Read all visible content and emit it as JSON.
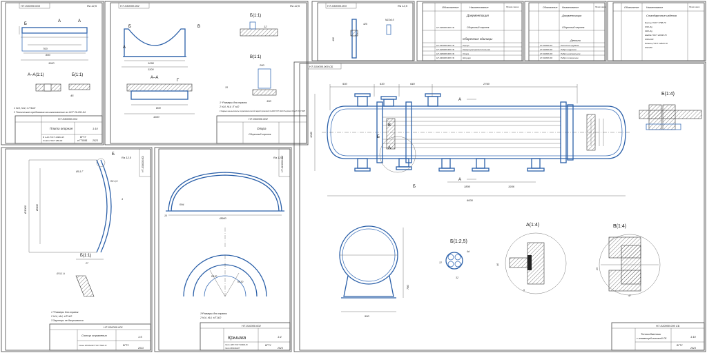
{
  "sheets": {
    "s1": {
      "stamp": "НТ-030000.004",
      "roughness": "Ra 12,5",
      "name": "Плита опорная",
      "mat1": "В 1-20 ГОСТ 19903-15",
      "mat2": "Ст3сп ГОСТ 380-94",
      "org1": "ВГТУ",
      "org2": "в ГТ0081",
      "year": "2023",
      "scale": "1:10",
      "section_aa": "A–A(1:1)",
      "view_b": "Б(1:1)",
      "label_b": "Б",
      "label_a": "A",
      "note1": "1 h14, h14, ± IT14/2",
      "note2": "2 Технические требования на изготовление по ОСТ 26-291-94",
      "dims": [
        "700",
        "800",
        "1100",
        "60",
        "45",
        "3"
      ]
    },
    "s2": {
      "stamp": "НТ-030000.002",
      "roughness": "Ra 12,5",
      "name": "Опора",
      "doc": "Сборочный чертеж",
      "section_aa": "A–A",
      "view_b": "Б(1:1)",
      "view_v": "В(1:1)",
      "label_b": "Б",
      "label_v": "В",
      "label_g": "Г",
      "label_a": "A",
      "note1": "1 *Размеры для справок",
      "note2": "2 h14, h14, IT ±t/2",
      "note3": "3 Сварные швы выполнить полуавтоматической сваркой проволокой Св-08А ГОСТ 2246-70 в флюсе ОСЦ-45 ГОСТ 9087",
      "dims": [
        "1090",
        "1100",
        "800",
        "120",
        "500",
        "400",
        "260",
        "200",
        "150",
        "12",
        "15"
      ]
    },
    "s3": {
      "stamp": "НТ-030000.003",
      "roughness": "Ra 12,5",
      "dims": [
        "425",
        "490",
        "M12x15",
        "8",
        "6"
      ]
    },
    "spec1": {
      "stamp": "НТ-030000.000 СБ",
      "head_col1": "Обозначение",
      "head_col2": "Наименование",
      "head_col3": "Приме-чание",
      "section1": "Документация",
      "row_doc": "Сборочный чертеж",
      "section2": "Сборочные единицы",
      "items": [
        "Корпус",
        "Камера распределительная",
        "Опора",
        "Штуцер"
      ],
      "codes": [
        "НТ-010000.000 СБ",
        "НТ-020000.000 СБ",
        "НТ-030000.000 СБ",
        "НТ-040000.000 СБ"
      ]
    },
    "spec2": {
      "section1": "Документация",
      "row_doc": "Сборочный чертеж",
      "section2": "Детали",
      "items": [
        "Решетка трубная",
        "Ребро наружное",
        "Ребро центральное",
        "Ребро поперечное"
      ],
      "codes": [
        "НТ-010000.001",
        "НТ-010000.002",
        "НТ-010000.003",
        "НТ-010000.004"
      ],
      "head_col1": "Обозначение",
      "head_col2": "Наименование",
      "head_col3": "Приме-чание"
    },
    "spec3": {
      "section1": "Стандартные изделия",
      "items": [
        "Болты ГОСТ 7798-70",
        "М16–6g",
        "М20–6g",
        "Шайба ГОСТ 22838-70",
        "М16x100",
        "Фланец ГОСТ 12820-70",
        "М12x80"
      ],
      "head_col1": "Обозначение",
      "head_col2": "Наименование",
      "head_col3": "Приме-чание"
    },
    "s4": {
      "stamp": "НТ-030000.001",
      "roughness": "Ra 12,5",
      "name": "Солнцо отражения",
      "mat": "Сталь 08Х18Н10Т ГОСТ 5632-72",
      "view_b": "Б(1:1)",
      "label_b": "Б",
      "note1": "1 *Размеры для справок",
      "note2": "2 h14, h14, ±IT14/2",
      "note3": "3 Заусенцы не допускаются",
      "dims": [
        "Ø1000",
        "Ø900",
        "R4 4,5",
        "4",
        "27",
        "Ø 0,1 А",
        "Ø0,1 Г"
      ],
      "scale": "1:5",
      "year": "2023",
      "org": "ВГТУ"
    },
    "s5": {
      "stamp": "НТ-010000.002",
      "roughness": "Ra 12,5",
      "name": "Крышка",
      "mat1": "Лист 10ГС ГОСТ 19903-15",
      "mat2": "Лист 08Х18Н10Т",
      "note1": "1*Размеры для справок",
      "note2": "2 h14, h14, ±IT14/2",
      "dims": [
        "Ø900",
        "R94",
        "R120",
        "R130",
        "10"
      ],
      "scale": "1:4",
      "year": "2023",
      "org": "ВГТУ"
    },
    "main": {
      "stamp": "НТ-010000.000 СБ",
      "code_top": "НТ-010000.000 СБ",
      "name1": "Теплообменник",
      "name2": "с плавающей головкой СБ",
      "scale": "1:10",
      "year": "2023",
      "org": "ВГТУ",
      "view_b14": "Б(1:4)",
      "view_a14": "А(1:4)",
      "view_v14": "В(1:4)",
      "view_b125": "Б(1:2,5)",
      "label_a": "А",
      "label_b": "Б",
      "label_v": "В",
      "dims_top": [
        "930",
        "630",
        "640",
        "2760"
      ],
      "dims_bottom": [
        "1800",
        "1936",
        "6000"
      ],
      "dims_left": [
        "1040"
      ],
      "dims_end": [
        "780",
        "500"
      ],
      "dims_det": [
        "4d",
        "12",
        "5",
        "32",
        "62",
        "46",
        "17",
        "25",
        "47"
      ]
    }
  }
}
